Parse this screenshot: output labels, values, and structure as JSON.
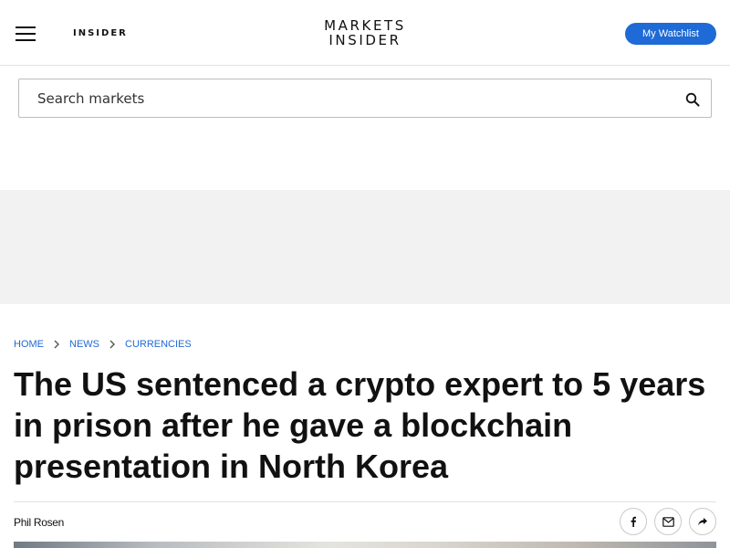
{
  "header": {
    "menu_icon": "hamburger-menu-icon",
    "insider_logo": "INSIDER",
    "logo_line1": "MARKETS",
    "logo_line2": "INSIDER",
    "watchlist_label": "My Watchlist",
    "accent_color": "#1e6ad6"
  },
  "search": {
    "placeholder": "Search markets",
    "value": "",
    "icon": "search-icon"
  },
  "breadcrumb": [
    {
      "label": "HOME"
    },
    {
      "label": "NEWS"
    },
    {
      "label": "CURRENCIES"
    }
  ],
  "article": {
    "title": "The US sentenced a crypto expert to 5 years in prison after he gave a blockchain presentation in North Korea",
    "author": "Phil Rosen",
    "share_icons": [
      "facebook-icon",
      "email-icon",
      "share-icon"
    ]
  }
}
